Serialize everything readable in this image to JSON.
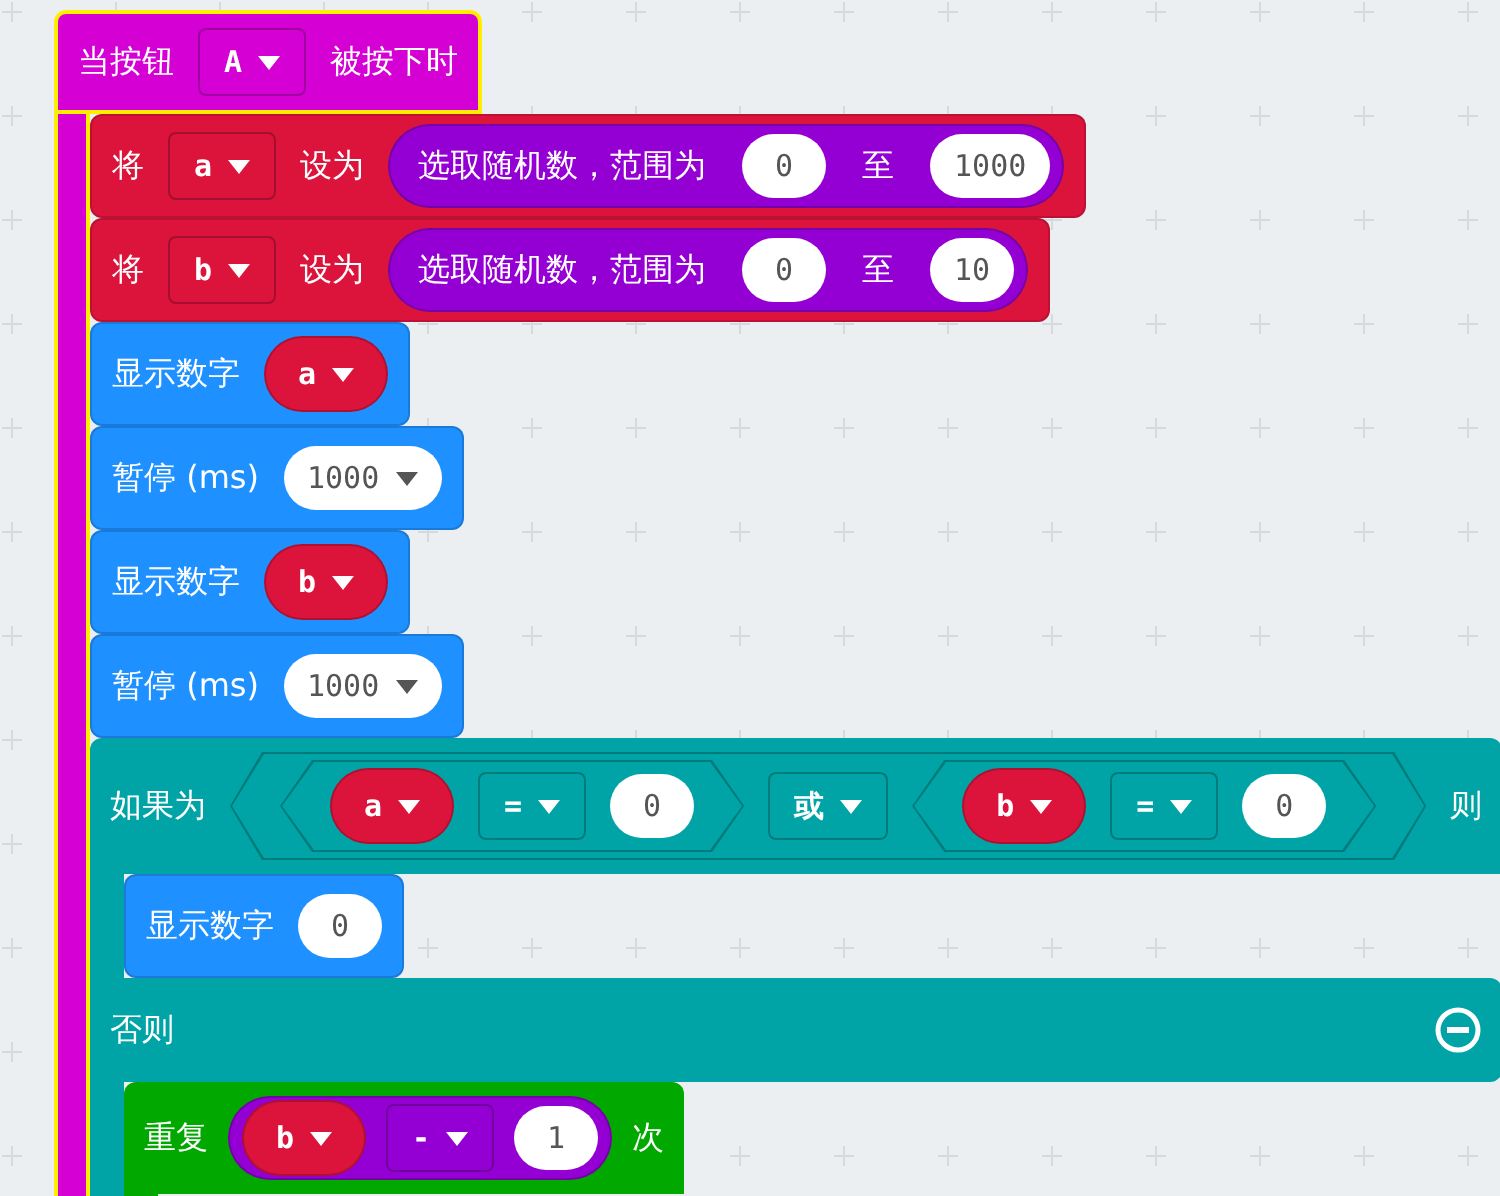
{
  "workspace": {
    "event_block": {
      "selected": true,
      "color": "#d400d4",
      "parts": [
        {
          "kind": "text",
          "text": "当按钮"
        },
        {
          "kind": "dropdown",
          "text": "A"
        },
        {
          "kind": "text",
          "text": "被按下时"
        }
      ],
      "body": [
        {
          "kind": "statement",
          "color": "#dc143c",
          "parts": [
            {
              "kind": "text",
              "text": "将"
            },
            {
              "kind": "dropdown",
              "text": "a"
            },
            {
              "kind": "text",
              "text": "设为"
            },
            {
              "kind": "reporter",
              "color": "#9400d3",
              "parts": [
                {
                  "kind": "text",
                  "text": "选取随机数，范围为"
                },
                {
                  "kind": "number",
                  "text": "0"
                },
                {
                  "kind": "text",
                  "text": "至"
                },
                {
                  "kind": "number",
                  "text": "1000"
                }
              ]
            }
          ]
        },
        {
          "kind": "statement",
          "color": "#dc143c",
          "parts": [
            {
              "kind": "text",
              "text": "将"
            },
            {
              "kind": "dropdown",
              "text": "b"
            },
            {
              "kind": "text",
              "text": "设为"
            },
            {
              "kind": "reporter",
              "color": "#9400d3",
              "parts": [
                {
                  "kind": "text",
                  "text": "选取随机数，范围为"
                },
                {
                  "kind": "number",
                  "text": "0"
                },
                {
                  "kind": "text",
                  "text": "至"
                },
                {
                  "kind": "number",
                  "text": "10"
                }
              ]
            }
          ]
        },
        {
          "kind": "statement",
          "color": "#1e90ff",
          "parts": [
            {
              "kind": "text",
              "text": "显示数字"
            },
            {
              "kind": "variable",
              "text": "a",
              "color": "#dc143c"
            }
          ]
        },
        {
          "kind": "statement",
          "color": "#1e90ff",
          "parts": [
            {
              "kind": "text",
              "text": "暂停 (ms)"
            },
            {
              "kind": "number_dropdown",
              "text": "1000"
            }
          ]
        },
        {
          "kind": "statement",
          "color": "#1e90ff",
          "parts": [
            {
              "kind": "text",
              "text": "显示数字"
            },
            {
              "kind": "variable",
              "text": "b",
              "color": "#dc143c"
            }
          ]
        },
        {
          "kind": "statement",
          "color": "#1e90ff",
          "parts": [
            {
              "kind": "text",
              "text": "暂停 (ms)"
            },
            {
              "kind": "number_dropdown",
              "text": "1000"
            }
          ]
        },
        {
          "kind": "if_else",
          "color": "#00a4a6",
          "parts": [
            {
              "kind": "text",
              "text": "如果为"
            },
            {
              "kind": "hexagon",
              "parts": [
                {
                  "kind": "hexagon",
                  "parts": [
                    {
                      "kind": "variable",
                      "text": "a",
                      "color": "#dc143c"
                    },
                    {
                      "kind": "dropdown",
                      "text": "="
                    },
                    {
                      "kind": "number",
                      "text": "0"
                    }
                  ]
                },
                {
                  "kind": "dropdown",
                  "text": "或"
                },
                {
                  "kind": "hexagon",
                  "parts": [
                    {
                      "kind": "variable",
                      "text": "b",
                      "color": "#dc143c"
                    },
                    {
                      "kind": "dropdown",
                      "text": "="
                    },
                    {
                      "kind": "number",
                      "text": "0"
                    }
                  ]
                }
              ]
            },
            {
              "kind": "text",
              "text": "则"
            }
          ],
          "body": [
            {
              "kind": "statement",
              "color": "#1e90ff",
              "parts": [
                {
                  "kind": "text",
                  "text": "显示数字"
                },
                {
                  "kind": "number",
                  "text": "0"
                }
              ]
            }
          ],
          "else_label": "否则",
          "else_body": [
            {
              "kind": "loop",
              "color": "#00a800",
              "parts": [
                {
                  "kind": "text",
                  "text": "重复"
                },
                {
                  "kind": "reporter",
                  "color": "#9400d3",
                  "parts": [
                    {
                      "kind": "variable",
                      "text": "b",
                      "color": "#dc143c"
                    },
                    {
                      "kind": "dropdown",
                      "text": "-"
                    },
                    {
                      "kind": "number",
                      "text": "1"
                    }
                  ]
                },
                {
                  "kind": "text",
                  "text": "次"
                }
              ]
            }
          ]
        }
      ]
    }
  }
}
